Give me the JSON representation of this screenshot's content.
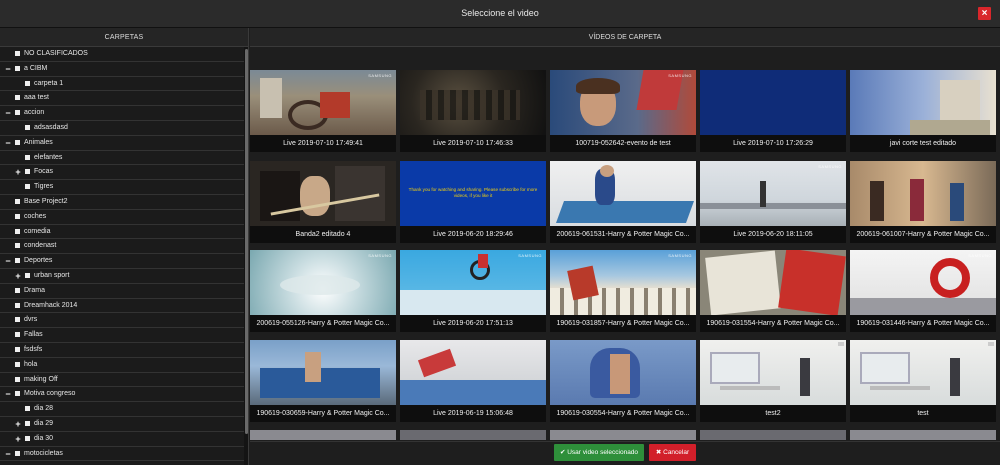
{
  "dialog": {
    "title": "Seleccione el video",
    "close_glyph": "×"
  },
  "left_panel": {
    "header": "CARPETAS",
    "tree": [
      {
        "label": "NO CLASIFICADOS",
        "depth": 0,
        "expander": ""
      },
      {
        "label": "a CIBM",
        "depth": 0,
        "expander": "−"
      },
      {
        "label": "carpeta 1",
        "depth": 1,
        "expander": ""
      },
      {
        "label": "aaa test",
        "depth": 0,
        "expander": ""
      },
      {
        "label": "accion",
        "depth": 0,
        "expander": "−"
      },
      {
        "label": "adsasdasd",
        "depth": 1,
        "expander": ""
      },
      {
        "label": "Animales",
        "depth": 0,
        "expander": "−"
      },
      {
        "label": "elefantes",
        "depth": 1,
        "expander": ""
      },
      {
        "label": "Focas",
        "depth": 1,
        "expander": "+"
      },
      {
        "label": "Tigres",
        "depth": 1,
        "expander": ""
      },
      {
        "label": "Base Project2",
        "depth": 0,
        "expander": ""
      },
      {
        "label": "coches",
        "depth": 0,
        "expander": ""
      },
      {
        "label": "comedia",
        "depth": 0,
        "expander": ""
      },
      {
        "label": "condenast",
        "depth": 0,
        "expander": ""
      },
      {
        "label": "Deportes",
        "depth": 0,
        "expander": "−"
      },
      {
        "label": "urban sport",
        "depth": 1,
        "expander": "+"
      },
      {
        "label": "Drama",
        "depth": 0,
        "expander": ""
      },
      {
        "label": "Dreamhack 2014",
        "depth": 0,
        "expander": ""
      },
      {
        "label": "dvrs",
        "depth": 0,
        "expander": ""
      },
      {
        "label": "Fallas",
        "depth": 0,
        "expander": ""
      },
      {
        "label": "fsdsfs",
        "depth": 0,
        "expander": ""
      },
      {
        "label": "hola",
        "depth": 0,
        "expander": ""
      },
      {
        "label": "making Off",
        "depth": 0,
        "expander": ""
      },
      {
        "label": "Motiva congreso",
        "depth": 0,
        "expander": "−"
      },
      {
        "label": "dia 28",
        "depth": 1,
        "expander": ""
      },
      {
        "label": "dia 29",
        "depth": 1,
        "expander": "+"
      },
      {
        "label": "dia 30",
        "depth": 1,
        "expander": "+"
      },
      {
        "label": "motocicletas",
        "depth": 0,
        "expander": "−"
      }
    ]
  },
  "right_panel": {
    "header": "VÍDEOS DE CARPETA",
    "videos": [
      {
        "title": "Live 2019-07-10 17:49:41",
        "thumb": "workshop",
        "overlay": "SAMSUNG"
      },
      {
        "title": "Live 2019-07-10 17:46:33",
        "thumb": "dark-street",
        "overlay": ""
      },
      {
        "title": "100719-052642-evento de test",
        "thumb": "boy",
        "overlay": "SAMSUNG"
      },
      {
        "title": "Live 2019-07-10 17:26:29",
        "thumb": "blue-screen",
        "overlay": ""
      },
      {
        "title": "javi corte test editado",
        "thumb": "blue-alley",
        "overlay": ""
      },
      {
        "title": "Banda2 editado 4",
        "thumb": "band",
        "overlay": ""
      },
      {
        "title": "Live 2019-06-20 18:29:46",
        "thumb": "end-card",
        "overlay": "Thank you for watching and sharing. Please subscribe for more videos, if you like it"
      },
      {
        "title": "200619-061531-Harry & Potter Magic Co...",
        "thumb": "billiards",
        "overlay": ""
      },
      {
        "title": "Live 2019-06-20 18:11:05",
        "thumb": "harbor",
        "overlay": "SAMSUNG"
      },
      {
        "title": "200619-061007-Harry & Potter Magic Co...",
        "thumb": "market",
        "overlay": ""
      },
      {
        "title": "200619-055126-Harry & Potter Magic Co...",
        "thumb": "splash",
        "overlay": "SAMSUNG"
      },
      {
        "title": "Live 2019-06-20 17:51:13",
        "thumb": "bmx",
        "overlay": "SAMSUNG"
      },
      {
        "title": "190619-031857-Harry & Potter Magic Co...",
        "thumb": "arches",
        "overlay": "SAMSUNG"
      },
      {
        "title": "190619-031554-Harry & Potter Magic Co...",
        "thumb": "magazine",
        "overlay": ""
      },
      {
        "title": "190619-031446-Harry & Potter Magic Co...",
        "thumb": "gym",
        "overlay": "SAMSUNG"
      },
      {
        "title": "190619-030659-Harry & Potter Magic Co...",
        "thumb": "boat",
        "overlay": ""
      },
      {
        "title": "Live 2019-06-19 15:06:48",
        "thumb": "jump",
        "overlay": ""
      },
      {
        "title": "190619-030554-Harry & Potter Magic Co...",
        "thumb": "blue-city",
        "overlay": ""
      },
      {
        "title": "test2",
        "thumb": "office",
        "overlay": ""
      },
      {
        "title": "test",
        "thumb": "office",
        "overlay": ""
      }
    ]
  },
  "footer": {
    "confirm_label": "Usar video seleccionado",
    "cancel_label": "Cancelar"
  },
  "colors": {
    "confirm": "#2e8f3a",
    "cancel": "#d21f2a",
    "close": "#d9262b"
  }
}
